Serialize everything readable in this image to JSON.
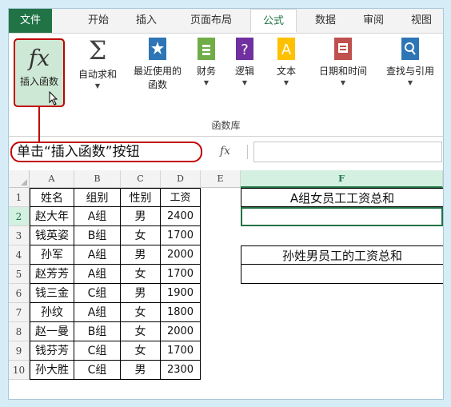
{
  "tabs": [
    "文件",
    "开始",
    "插入",
    "页面布局",
    "公式",
    "数据",
    "审阅",
    "视图"
  ],
  "ribbon": {
    "insert_function": {
      "glyph": "fx",
      "label": "插入函数"
    },
    "autosum": {
      "label": "自动求和"
    },
    "recent": {
      "label1": "最近使用的",
      "label2": "函数"
    },
    "finance": {
      "label": "财务"
    },
    "logic": {
      "label": "逻辑"
    },
    "text": {
      "label": "文本"
    },
    "datetime": {
      "label": "日期和时间"
    },
    "lookup": {
      "label": "查找与引用"
    },
    "group_label": "函数库"
  },
  "callout": "单击“插入函数”按钮",
  "formula_bar": {
    "fx": "fx",
    "value": ""
  },
  "columns": [
    "A",
    "B",
    "C",
    "D",
    "E",
    "F"
  ],
  "rows": [
    {
      "n": "1",
      "a": "姓名",
      "b": "组别",
      "c": "性别",
      "d": "工资",
      "f": "A组女员工工资总和"
    },
    {
      "n": "2",
      "a": "赵大年",
      "b": "A组",
      "c": "男",
      "d": "2400",
      "f": ""
    },
    {
      "n": "3",
      "a": "钱英姿",
      "b": "B组",
      "c": "女",
      "d": "1700",
      "f": ""
    },
    {
      "n": "4",
      "a": "孙军",
      "b": "A组",
      "c": "男",
      "d": "2000",
      "f": "孙姓男员工的工资总和"
    },
    {
      "n": "5",
      "a": "赵芳芳",
      "b": "A组",
      "c": "女",
      "d": "1700",
      "f": ""
    },
    {
      "n": "6",
      "a": "钱三金",
      "b": "C组",
      "c": "男",
      "d": "1900",
      "f": ""
    },
    {
      "n": "7",
      "a": "孙纹",
      "b": "A组",
      "c": "女",
      "d": "1800",
      "f": ""
    },
    {
      "n": "8",
      "a": "赵一曼",
      "b": "B组",
      "c": "女",
      "d": "2000",
      "f": ""
    },
    {
      "n": "9",
      "a": "钱芬芳",
      "b": "C组",
      "c": "女",
      "d": "1700",
      "f": ""
    },
    {
      "n": "10",
      "a": "孙大胜",
      "b": "C组",
      "c": "男",
      "d": "2300",
      "f": ""
    }
  ],
  "colors": {
    "accent": "#217346",
    "callout": "#c00000"
  }
}
